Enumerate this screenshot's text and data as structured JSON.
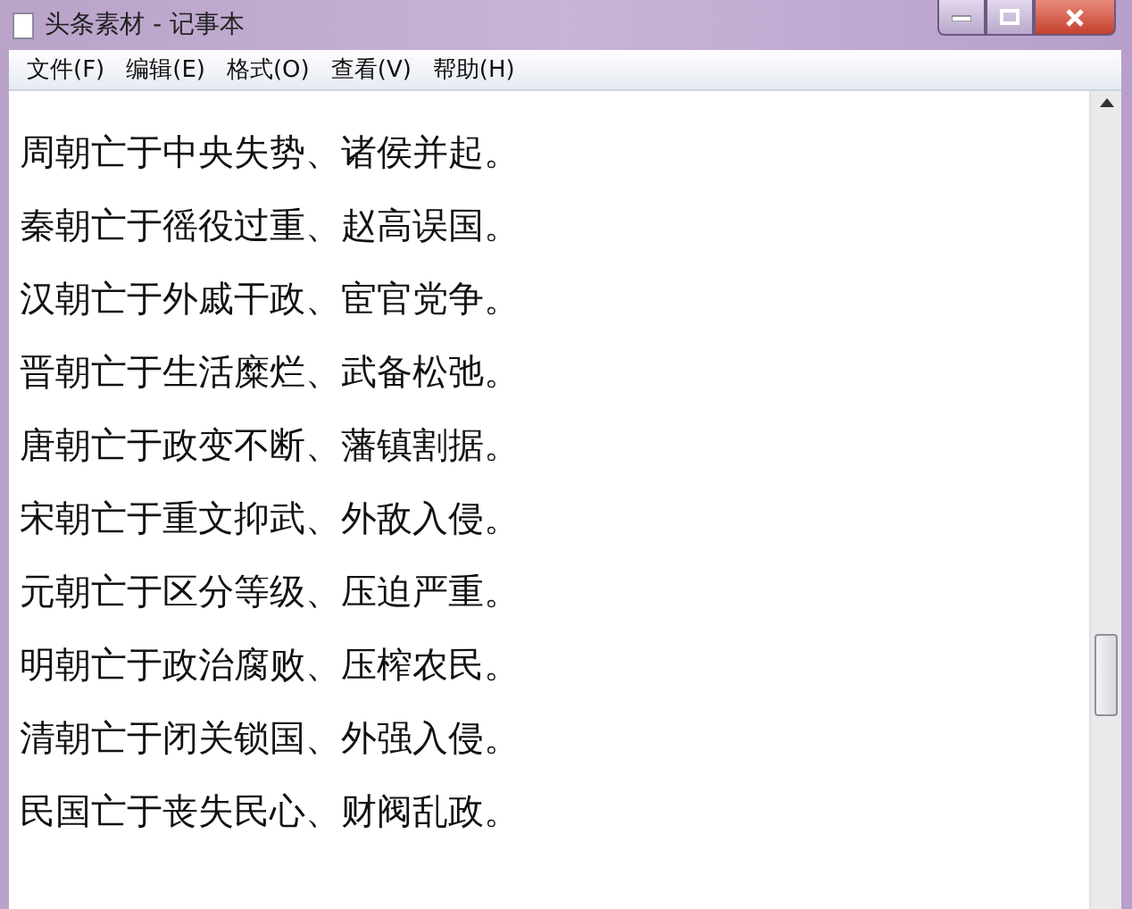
{
  "window": {
    "title": "头条素材 - 记事本"
  },
  "menu": [
    "文件(F)",
    "编辑(E)",
    "格式(O)",
    "查看(V)",
    "帮助(H)"
  ],
  "lines": [
    "周朝亡于中央失势、诸侯并起。",
    "秦朝亡于徭役过重、赵高误国。",
    "汉朝亡于外戚干政、宦官党争。",
    "晋朝亡于生活糜烂、武备松弛。",
    "唐朝亡于政变不断、藩镇割据。",
    "宋朝亡于重文抑武、外敌入侵。",
    "元朝亡于区分等级、压迫严重。",
    "明朝亡于政治腐败、压榨农民。",
    "清朝亡于闭关锁国、外强入侵。",
    "民国亡于丧失民心、财阀乱政。"
  ]
}
